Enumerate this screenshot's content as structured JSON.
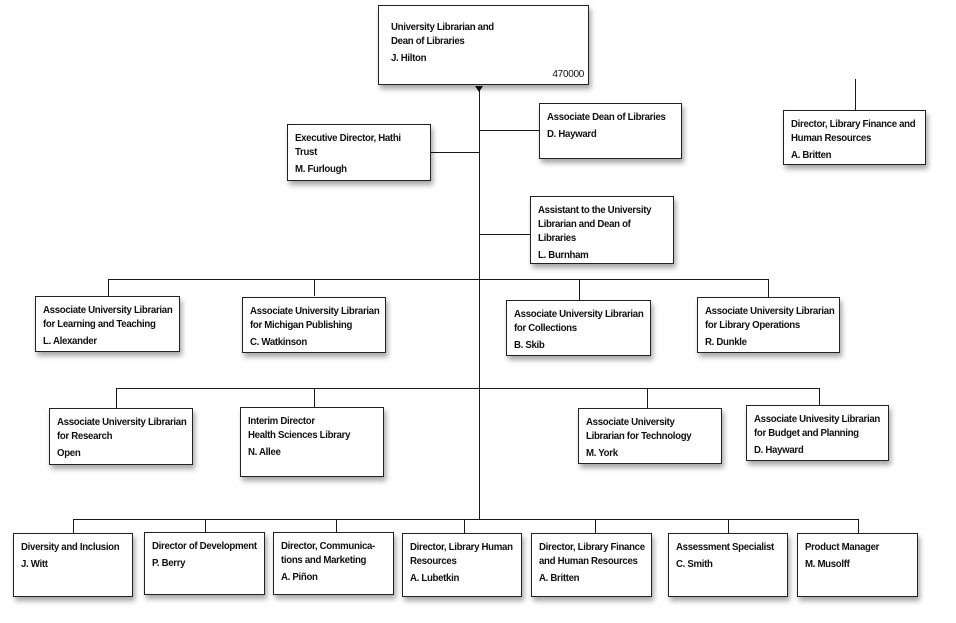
{
  "diagram": {
    "type": "org-chart",
    "root": {
      "id": "ul",
      "title": "University Librarian and\nDean of Libraries",
      "person": "J. Hilton",
      "code": "470000"
    },
    "staff_direct": [
      {
        "id": "hathi",
        "title": "Executive Director, Hathi\nTrust",
        "person": "M. Furlough"
      },
      {
        "id": "assocdean",
        "title": "Associate Dean of Libraries",
        "person": "D. Hayward"
      },
      {
        "id": "assistant",
        "title": "Assistant to the University\nLibrarian and Dean of\nLibraries",
        "person": "L. Burnham"
      }
    ],
    "detached": [
      {
        "id": "finance-top",
        "title": "Director, Library Finance and\nHuman Resources",
        "person": "A. Britten"
      }
    ],
    "tier1": [
      {
        "id": "aul-lt",
        "title": "Associate University Librarian\nfor Learning and Teaching",
        "person": "L. Alexander"
      },
      {
        "id": "aul-mp",
        "title": "Associate University Librarian\nfor Michigan Publishing",
        "person": "C. Watkinson"
      },
      {
        "id": "aul-col",
        "title": "Associate University Librarian\nfor Collections",
        "person": "B. Skib"
      },
      {
        "id": "aul-ops",
        "title": "Associate University Librarian\nfor Library Operations",
        "person": "R. Dunkle"
      }
    ],
    "tier2": [
      {
        "id": "aul-res",
        "title": "Associate University Librarian\nfor Research",
        "person": "Open"
      },
      {
        "id": "hsl",
        "title": "Interim Director\nHealth Sciences Library",
        "person": "N. Allee"
      },
      {
        "id": "aul-tech",
        "title": "Associate University\nLibrarian for Technology",
        "person": "M. York"
      },
      {
        "id": "aul-bp",
        "title": "Associate Univesity Librarian\nfor Budget and Planning",
        "person": "D. Hayward"
      }
    ],
    "tier3": [
      {
        "id": "dei",
        "title": "Diversity and Inclusion\n ",
        "person": "J. Witt"
      },
      {
        "id": "dev",
        "title": "Director of Development\n ",
        "person": "P. Berry"
      },
      {
        "id": "comm",
        "title": "Director, Communica-\ntions and Marketing",
        "person": "A. Piñon"
      },
      {
        "id": "hr",
        "title": "Director, Library Human\nResources",
        "person": "A. Lubetkin"
      },
      {
        "id": "finance",
        "title": "Director, Library Finance\nand Human Resources",
        "person": "A. Britten"
      },
      {
        "id": "assess",
        "title": "Assessment Specialist",
        "person": "C. Smith"
      },
      {
        "id": "pm",
        "title": "Product Manager",
        "person": "M. Musolff"
      }
    ]
  },
  "colors": {
    "line": "#1a1a1a",
    "box_border": "#222222",
    "background": "#ffffff"
  }
}
